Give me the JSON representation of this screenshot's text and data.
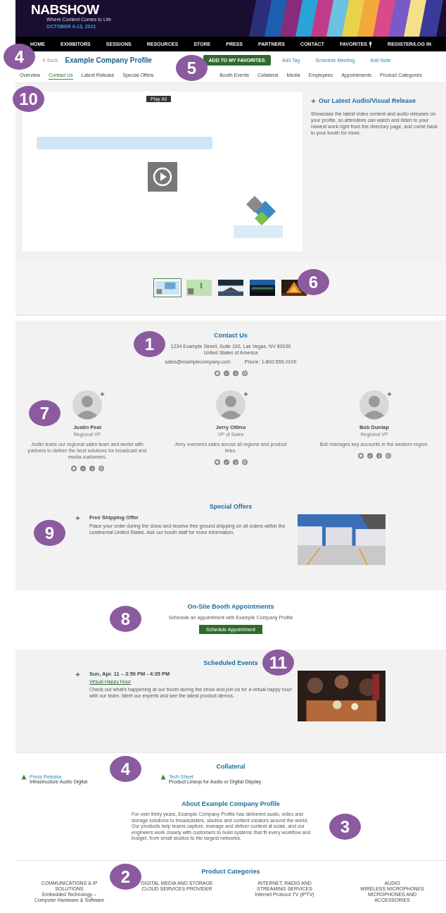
{
  "banner": {
    "logo": "NABSHOW",
    "tagline": "Where Content Comes to Life",
    "dates": "OCTOBER 9-13, 2021"
  },
  "nav": [
    {
      "label": "HOME",
      "kind": "text"
    },
    {
      "label": "EXHIBITORS",
      "kind": "text"
    },
    {
      "label": "SESSIONS",
      "kind": "text"
    },
    {
      "label": "RESOURCES",
      "kind": "text"
    },
    {
      "label": "STORE",
      "kind": "text"
    },
    {
      "label": "PRESS",
      "kind": "text"
    },
    {
      "label": "PARTNERS",
      "kind": "text"
    },
    {
      "label": "CONTACT",
      "kind": "text"
    },
    {
      "label": "FAVORITES",
      "kind": "icon"
    },
    {
      "label": "REGISTER/LOG IN",
      "kind": "text"
    }
  ],
  "profile_header": {
    "back": "Back",
    "title": "Example Company Profile",
    "primary_action": "ADD TO MY FAVORITES",
    "actions": [
      "Add Tag",
      "Schedule Meeting",
      "Add Note"
    ]
  },
  "tabs": [
    {
      "label": "Overview",
      "selected": false
    },
    {
      "label": "Contact Us",
      "selected": true
    },
    {
      "label": "Latest Release",
      "selected": false
    },
    {
      "label": "Special Offers",
      "selected": false
    },
    {
      "label": "Booth Events",
      "selected": false
    },
    {
      "label": "Collateral",
      "selected": false
    },
    {
      "label": "Media",
      "selected": false
    },
    {
      "label": "Employees",
      "selected": false
    },
    {
      "label": "Appointments",
      "selected": false
    },
    {
      "label": "Product Categories",
      "selected": false
    }
  ],
  "media": {
    "video_tab": "Play All",
    "release_title": "Our Latest Audio/Visual Release",
    "release_text": "Showcase the latest video content and audio releases on your profile, so attendees can watch and listen to your newest work right from the directory page, and come back to your booth for more.",
    "thumbnails": [
      {
        "selected": true
      },
      {
        "selected": false
      },
      {
        "selected": false
      },
      {
        "selected": false
      },
      {
        "selected": false
      }
    ]
  },
  "contact": {
    "title": "Contact Us",
    "address": [
      "1234 Example Street, Suite 100, Las Vegas, NV 89109",
      "United States of America"
    ],
    "email": "sales@examplecompany.com",
    "phone": "Phone: 1-800-555-0100",
    "people": [
      {
        "name": "Justin Peal",
        "role": "Regional VP",
        "bio": "Justin leads our regional sales team and works with partners to deliver the best solutions for broadcast and media customers."
      },
      {
        "name": "Jerry Ottino",
        "role": "VP of Sales",
        "bio": "Jerry oversees sales across all regions and product lines."
      },
      {
        "name": "Bob Dunlap",
        "role": "Regional VP",
        "bio": "Bob manages key accounts in the western region."
      }
    ]
  },
  "offers": {
    "title": "Special Offers",
    "items": [
      {
        "name": "Free Shipping Offer",
        "text": "Place your order during the show and receive free ground shipping on all orders within the continental United States. Ask our booth staff for more information."
      }
    ]
  },
  "appointments": {
    "title": "On-Site Booth Appointments",
    "text": "Schedule an appointment with Example Company Profile",
    "button": "Schedule Appointment"
  },
  "events": {
    "title": "Scheduled Events",
    "items": [
      {
        "when": "Sun, Apr. 11  –  3:50 PM - 4:35 PM",
        "link": "Virtual Happy Hour",
        "text": "Check out what's happening at our booth during the show and join us for a virtual happy hour with our team. Meet our experts and see the latest product demos."
      }
    ]
  },
  "collateral": {
    "title": "Collateral",
    "items": [
      {
        "link": "Press Release",
        "text": "Infrastructure Audio Digital"
      },
      {
        "link": "Tech Sheet",
        "text": "Product Lineup for Audio or Digital Display"
      }
    ]
  },
  "about": {
    "title": "About Example Company Profile",
    "text": "For over thirty years, Example Company Profile has delivered audio, video and storage solutions to broadcasters, studios and content creators around the world. Our products help teams capture, manage and deliver content at scale, and our engineers work closely with customers to build systems that fit every workflow and budget, from small studios to the largest networks."
  },
  "categories": {
    "title": "Product Categories",
    "columns": [
      [
        "COMMUNICATIONS & IP SOLUTIONS",
        "Embedded Technology – Computer Hardware & Software"
      ],
      [
        "DIGITAL MEDIA AND STORAGE",
        "CLOUD SERVICES PROVIDER"
      ],
      [
        "INTERNET, RADIO AND STREAMING SERVICES",
        "Internet Protocol TV (IPTV)"
      ],
      [
        "AUDIO",
        "WIRELESS MICROPHONES",
        "MICROPHONES AND ACCESSORIES"
      ]
    ]
  },
  "callouts": [
    "4",
    "5",
    "10",
    "6",
    "1",
    "7",
    "9",
    "8",
    "11",
    "4",
    "3",
    "2"
  ]
}
